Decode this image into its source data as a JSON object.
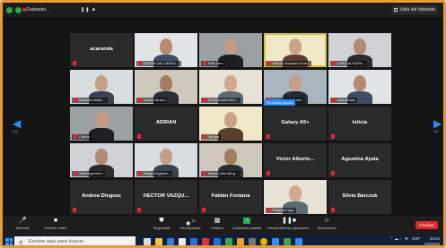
{
  "topbar": {
    "recording_label": "Grabando...",
    "recording_controls": "❚❚ ■",
    "view_button": "Vista del hablante"
  },
  "nav": {
    "left_page": "1/2",
    "right_page": "1/2"
  },
  "rename_popup": "Re-Iniciar Ayuda",
  "tiles": [
    {
      "name": "acaranda",
      "caption": "",
      "type": "name"
    },
    {
      "name": "",
      "caption": "NOTRE DE CAPACI...",
      "type": "cam"
    },
    {
      "name": "",
      "caption": "Raft Sam",
      "type": "cam"
    },
    {
      "name": "",
      "caption": "Alvaro Gonzalez Due...",
      "type": "cam",
      "active": true
    },
    {
      "name": "",
      "caption": "GARCIA HORA...",
      "type": "cam"
    },
    {
      "name": "",
      "caption": "Marcelo Martin...",
      "type": "cam"
    },
    {
      "name": "",
      "caption": "Dalana Braun",
      "type": "cam"
    },
    {
      "name": "",
      "caption": "ELENA MALDEZ...",
      "type": "cam"
    },
    {
      "name": "",
      "caption": "Pablo Martin Trejo",
      "type": "cam"
    },
    {
      "name": "",
      "caption": "avcoaPaye",
      "type": "cam"
    },
    {
      "name": "",
      "caption": "Carina",
      "type": "cam"
    },
    {
      "name": "ADRIAN",
      "caption": "",
      "type": "name"
    },
    {
      "name": "",
      "caption": "Jnrosa",
      "type": "cam"
    },
    {
      "name": "Galaxy A5+",
      "caption": "",
      "type": "name"
    },
    {
      "name": "leticia",
      "caption": "",
      "type": "name"
    },
    {
      "name": "",
      "caption": "Sad Kupermen",
      "type": "cam"
    },
    {
      "name": "",
      "caption": "Diego Edgardo...",
      "type": "cam"
    },
    {
      "name": "",
      "caption": "Maria Celia Berg...",
      "type": "cam"
    },
    {
      "name": "Victor Alberto...",
      "caption": "",
      "type": "name"
    },
    {
      "name": "Agustina Ayala",
      "caption": "",
      "type": "name"
    },
    {
      "name": "Andrea Dieguez",
      "caption": "",
      "type": "name"
    },
    {
      "name": "HECTOR VAZQU...",
      "caption": "",
      "type": "name"
    },
    {
      "name": "Fabián Fontana",
      "caption": "",
      "type": "name"
    },
    {
      "name": "",
      "caption": "Pamela Lugo",
      "type": "cam"
    },
    {
      "name": "Silvia Barczuk",
      "caption": "",
      "type": "name"
    }
  ],
  "toolbar": {
    "unmute": "Silenciar",
    "video": "Detener video",
    "security": "Seguridad",
    "participants": "Participantes",
    "participants_count": "27",
    "chat": "Chatear",
    "share": "Compartir pantalla",
    "record": "Pausar/detener grabación",
    "reactions": "Reacciones",
    "end": "Finalizar"
  },
  "taskbar": {
    "search_placeholder": "Escribe aquí para buscar",
    "language": "ESP",
    "time": "18:22",
    "date": "7/6/2020"
  },
  "colors": {
    "accent": "#2d8cff",
    "end": "#e02828",
    "frame": "#e89a36",
    "active_speaker": "#d6c334"
  }
}
